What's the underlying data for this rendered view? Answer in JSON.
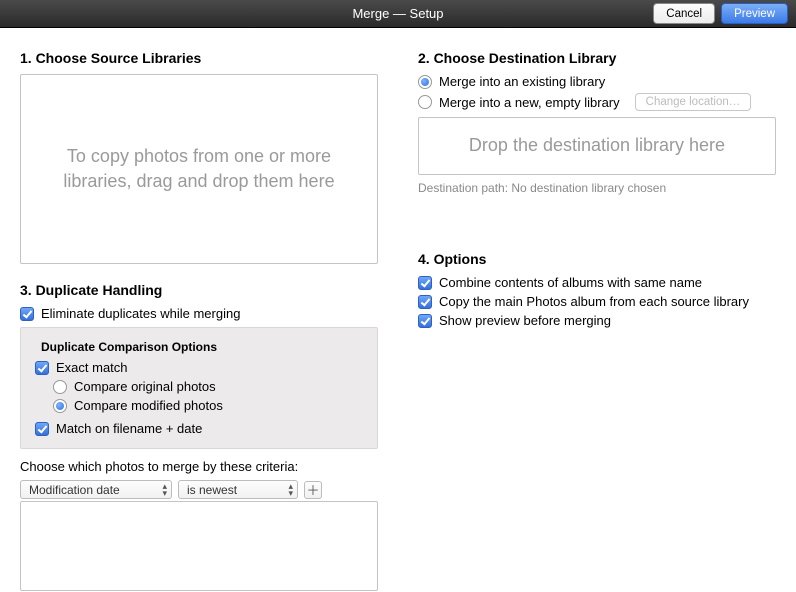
{
  "titlebar": {
    "title": "Merge — Setup",
    "cancel": "Cancel",
    "preview": "Preview"
  },
  "section1": {
    "heading": "1. Choose Source Libraries",
    "drop_hint": "To copy photos from one or more libraries, drag and drop them here"
  },
  "section2": {
    "heading": "2. Choose Destination Library",
    "opt_existing": "Merge into an existing library",
    "opt_new": "Merge into a new, empty library",
    "change_loc": "Change location…",
    "drop_hint": "Drop the destination library here",
    "path_label": "Destination path: No destination library chosen"
  },
  "section3": {
    "heading": "3. Duplicate Handling",
    "eliminate": "Eliminate duplicates while merging",
    "compare_heading": "Duplicate Comparison Options",
    "exact": "Exact match",
    "compare_orig": "Compare original photos",
    "compare_mod": "Compare modified photos",
    "match_filename": "Match on filename + date",
    "criteria_label": "Choose which photos to merge by these criteria:",
    "criteria_field": "Modification date",
    "criteria_op": "is newest"
  },
  "section4": {
    "heading": "4. Options",
    "combine": "Combine contents of albums with same name",
    "copy_main": "Copy the main Photos album from each source library",
    "show_preview": "Show preview before merging"
  }
}
